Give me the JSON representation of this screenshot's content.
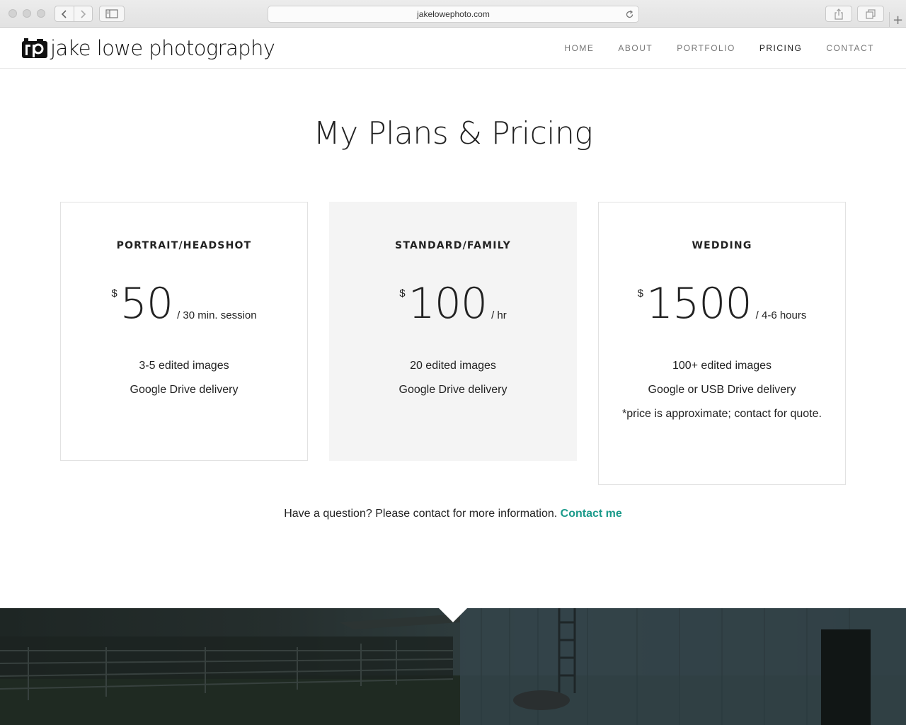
{
  "browser": {
    "url": "jakelowephoto.com"
  },
  "site": {
    "logo_text": "jake lowe photography",
    "nav": [
      {
        "label": "HOME"
      },
      {
        "label": "ABOUT"
      },
      {
        "label": "PORTFOLIO"
      },
      {
        "label": "PRICING",
        "active": true
      },
      {
        "label": "CONTACT"
      }
    ]
  },
  "pricing": {
    "title": "My Plans & Pricing",
    "currency_symbol": "$",
    "plans": [
      {
        "name": "PORTRAIT/HEADSHOT",
        "amount": "50",
        "period": "/ 30 min. session",
        "features": [
          "3-5 edited images",
          "Google Drive delivery"
        ]
      },
      {
        "name": "STANDARD/FAMILY",
        "amount": "100",
        "period": "/ hr",
        "features": [
          "20 edited images",
          "Google Drive delivery"
        ]
      },
      {
        "name": "WEDDING",
        "amount": "1500",
        "period": "/ 4-6 hours",
        "features": [
          "100+ edited images",
          "Google or USB Drive delivery",
          "*price is approximate; contact for quote."
        ]
      }
    ]
  },
  "cta": {
    "text": "Have a question? Please contact for more information.",
    "link_label": "Contact me"
  },
  "colors": {
    "accent": "#1a9a8a",
    "featured_card_bg": "#f4f4f4"
  }
}
